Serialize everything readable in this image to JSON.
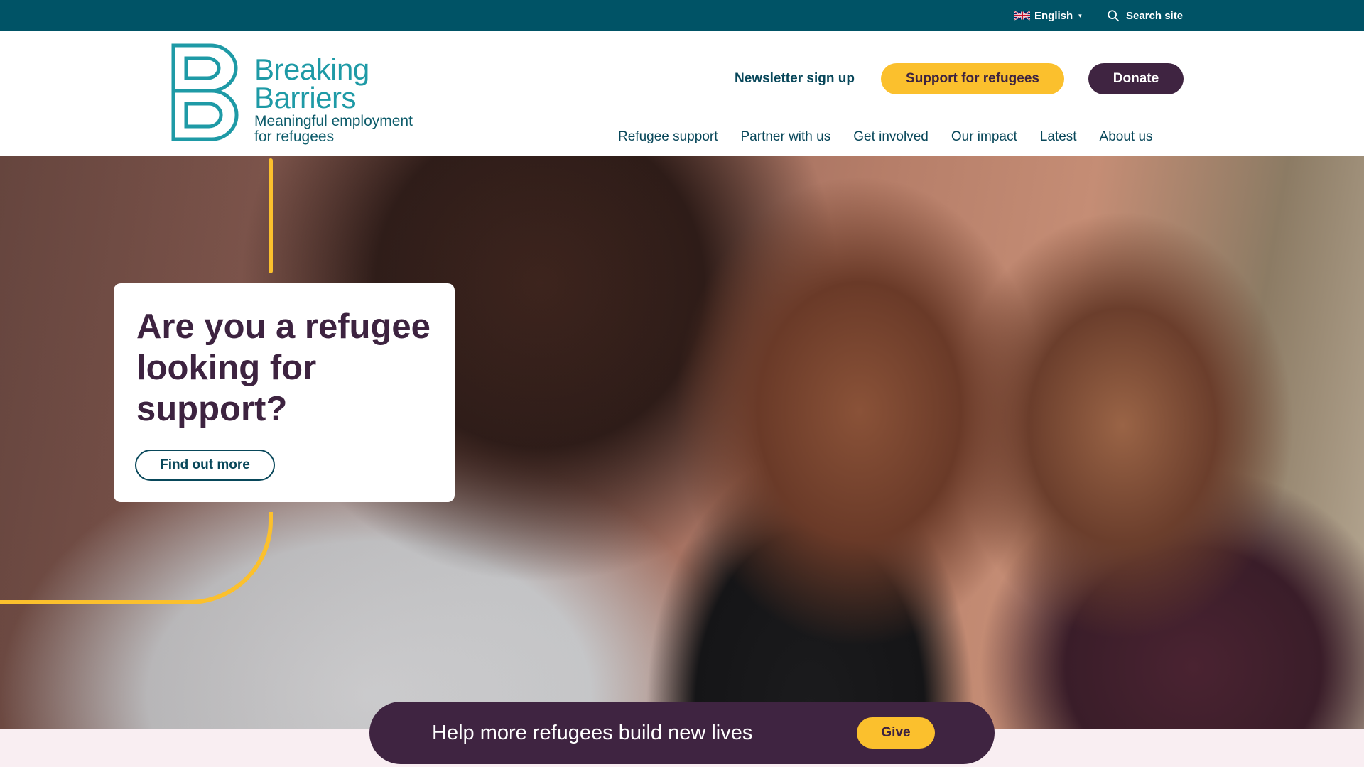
{
  "topbar": {
    "language_label": "English",
    "language_flag_icon": "uk-flag-icon",
    "search_label": "Search site",
    "search_icon": "search-icon",
    "background_color": "#005366"
  },
  "header": {
    "logo": {
      "name_line1": "Breaking",
      "name_line2": "Barriers",
      "tagline_line1": "Meaningful employment",
      "tagline_line2": "for refugees"
    },
    "newsletter_label": "Newsletter sign up",
    "support_label": "Support for refugees",
    "donate_label": "Donate",
    "nav": [
      "Refugee support",
      "Partner with us",
      "Get involved",
      "Our impact",
      "Latest",
      "About us"
    ]
  },
  "hero": {
    "card_title": "Are you a refugee looking for support?",
    "card_button": "Find out more"
  },
  "donate_bar": {
    "text": "Help more refugees build new lives",
    "button": "Give"
  },
  "colors": {
    "accent_yellow": "#fbc02d",
    "brand_purple": "#3f2441",
    "brand_teal": "#1e9aa6",
    "navy_text": "#08475a"
  }
}
